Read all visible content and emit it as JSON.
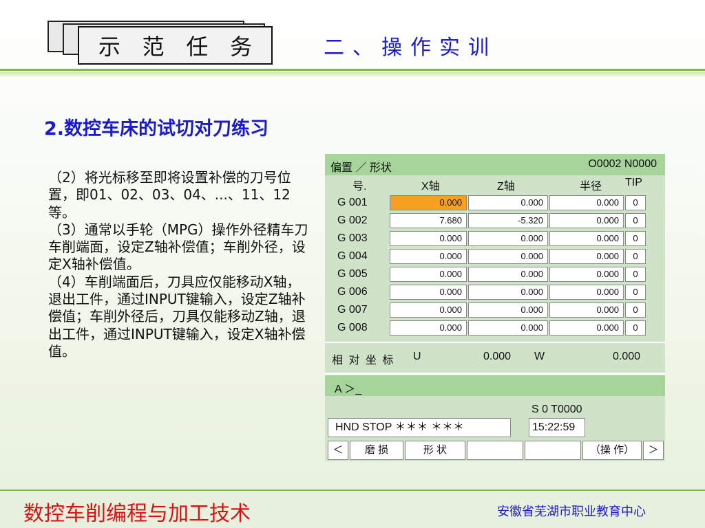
{
  "header": {
    "task_label": [
      "示",
      "范",
      "任",
      "务"
    ],
    "section_title": "二、操作实训"
  },
  "subtitle": "2.数控车床的试切对刀练习",
  "body": {
    "paragraphs": [
      "（2）将光标移至即将设置补偿的刀号位置，即01、02、03、04、...、11、12等。",
      "（3）通常以手轮（MPG）操作外径精车刀车削端面，设定Z轴补偿值；车削外径，设定X轴补偿值。",
      "（4）车削端面后，刀具应仅能移动X轴，退出工件，通过INPUT键输入，设定Z轴补偿值；车削外径后，刀具仅能移动Z轴，退出工件，通过INPUT键输入，设定X轴补偿值。"
    ]
  },
  "panel": {
    "title_left": "偏置 ／ 形状",
    "title_right": "O0002  N0000",
    "headers": {
      "no": "号.",
      "x": "X轴",
      "z": "Z轴",
      "r": "半径",
      "tip": "TIP"
    },
    "rows": [
      {
        "no": "G 001",
        "x": "0.000",
        "z": "0.000",
        "r": "0.000",
        "tip": "0"
      },
      {
        "no": "G 002",
        "x": "7.680",
        "z": "-5.320",
        "r": "0.000",
        "tip": "0"
      },
      {
        "no": "G 003",
        "x": "0.000",
        "z": "0.000",
        "r": "0.000",
        "tip": "0"
      },
      {
        "no": "G 004",
        "x": "0.000",
        "z": "0.000",
        "r": "0.000",
        "tip": "0"
      },
      {
        "no": "G 005",
        "x": "0.000",
        "z": "0.000",
        "r": "0.000",
        "tip": "0"
      },
      {
        "no": "G 006",
        "x": "0.000",
        "z": "0.000",
        "r": "0.000",
        "tip": "0"
      },
      {
        "no": "G 007",
        "x": "0.000",
        "z": "0.000",
        "r": "0.000",
        "tip": "0"
      },
      {
        "no": "G 008",
        "x": "0.000",
        "z": "0.000",
        "r": "0.000",
        "tip": "0"
      }
    ],
    "relative": {
      "label": "相 对 坐 标",
      "u_label": "U",
      "u_value": "0.000",
      "w_label": "W",
      "w_value": "0.000"
    },
    "prompt": "A ＞_",
    "spindle": "S     0 T0000",
    "mode": "HND   STOP   ＊＊＊ ＊＊＊",
    "time": "15:22:59",
    "softkeys": {
      "left": "＜",
      "wear": "磨 损",
      "shape": "形 状",
      "op": "（操 作）",
      "right": "＞"
    }
  },
  "footer": {
    "title": "数控车削编程与加工技术",
    "org": "安徽省芜湖市职业教育中心"
  }
}
